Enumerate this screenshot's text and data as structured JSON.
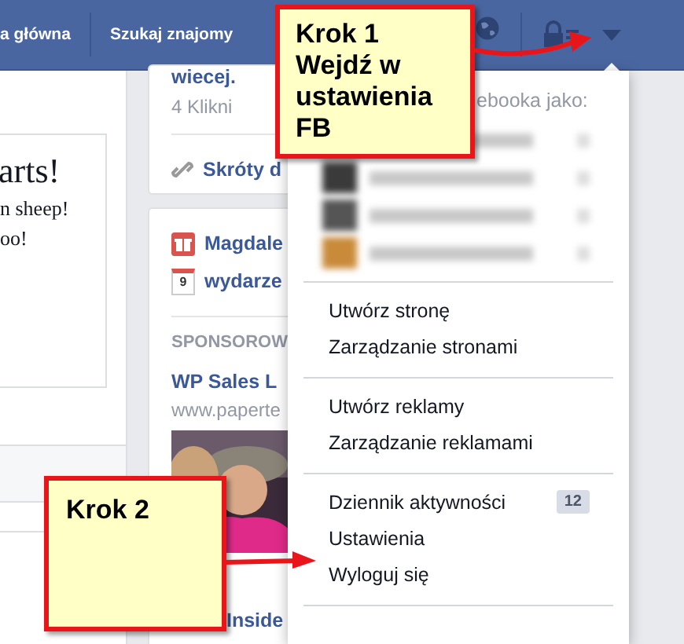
{
  "top_bar": {
    "nav_items": [
      "a główna",
      "Szukaj znajomy"
    ]
  },
  "left_card": {
    "heading": "arts!",
    "lines": [
      "n sheep!",
      "oo!"
    ]
  },
  "middle": {
    "card_1": {
      "link": "wiecej.",
      "meta": "4 Klikni",
      "shortcut": "Skróty d"
    },
    "card_2": {
      "birthday": "Magdale",
      "event_day": "9",
      "event": "wydarze",
      "sponsored_heading": "SPONSOROW",
      "ad_title": "WP Sales L",
      "ad_url": "www.paperte",
      "ad_2_title": "Inside"
    }
  },
  "dropdown": {
    "use_as": "ebooka jako:",
    "sections": [
      [
        {
          "label": "Utwórz stronę"
        },
        {
          "label": "Zarządzanie stronami"
        }
      ],
      [
        {
          "label": "Utwórz reklamy"
        },
        {
          "label": "Zarządzanie reklamami"
        }
      ],
      [
        {
          "label": "Dziennik aktywności",
          "badge": "12"
        },
        {
          "label": "Ustawienia"
        },
        {
          "label": "Wyloguj się"
        }
      ]
    ]
  },
  "notes": [
    {
      "lines": [
        "Krok 1",
        "Wejdź w",
        "ustawienia",
        "FB"
      ]
    },
    {
      "lines": [
        "Krok 2"
      ]
    }
  ]
}
